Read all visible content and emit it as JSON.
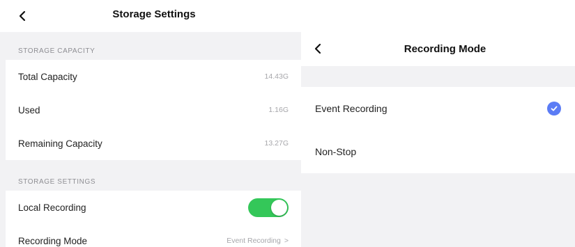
{
  "storage": {
    "title": "Storage Settings",
    "capacity_header": "STORAGE CAPACITY",
    "total_label": "Total Capacity",
    "total_value": "14.43G",
    "used_label": "Used",
    "used_value": "1.16G",
    "remaining_label": "Remaining Capacity",
    "remaining_value": "13.27G",
    "settings_header": "STORAGE SETTINGS",
    "local_recording_label": "Local Recording",
    "local_recording_on": true,
    "recording_mode_label": "Recording Mode",
    "recording_mode_value": "Event Recording",
    "chevron": ">"
  },
  "recording_mode": {
    "title": "Recording Mode",
    "options": [
      {
        "label": "Event Recording",
        "selected": true
      },
      {
        "label": "Non-Stop",
        "selected": false
      }
    ]
  },
  "colors": {
    "toggle_on": "#34c759",
    "check": "#5b7cf5",
    "background": "#f2f2f4"
  },
  "icons": {
    "back": "chevron-left-icon",
    "check": "checkmark-circle-icon"
  }
}
